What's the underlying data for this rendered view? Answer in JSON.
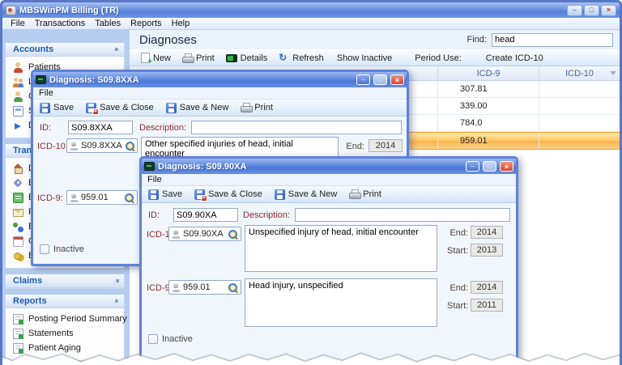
{
  "window": {
    "title": "MBSWinPM Billing (TR)",
    "app_icon": "app-icon"
  },
  "controls": {
    "minimize": "–",
    "maximize": "□",
    "close": "×"
  },
  "menubar": {
    "items": [
      "File",
      "Transactions",
      "Tables",
      "Reports",
      "Help"
    ]
  },
  "sidebar": {
    "sections": [
      {
        "title": "Accounts",
        "collapsed": false,
        "items": [
          {
            "label": "Patients",
            "icon": "person-red-icon"
          },
          {
            "label": "L",
            "icon": "people-pair-icon"
          },
          {
            "label": "C",
            "icon": "person-green-icon"
          },
          {
            "label": "S",
            "icon": "card-icon"
          },
          {
            "label": "D",
            "icon": "arrow-blue-icon"
          }
        ]
      },
      {
        "title": "Transactions",
        "collapsed": false,
        "items": [
          {
            "label": "D",
            "icon": "house-icon"
          },
          {
            "label": "B",
            "icon": "tag-icon"
          },
          {
            "label": "B",
            "icon": "note-icon"
          },
          {
            "label": "P",
            "icon": "envelope-icon"
          },
          {
            "label": "B",
            "icon": "people-sync-icon"
          },
          {
            "label": "C",
            "icon": "calendar-icon"
          },
          {
            "label": "B",
            "icon": "coins-icon"
          }
        ]
      },
      {
        "title": "Claims",
        "collapsed": true,
        "items": []
      },
      {
        "title": "Reports",
        "collapsed": false,
        "items": [
          {
            "label": "Posting Period Summary",
            "icon": "report-icon"
          },
          {
            "label": "Statements",
            "icon": "report-icon"
          },
          {
            "label": "Patient Aging",
            "icon": "report-icon"
          }
        ]
      }
    ]
  },
  "main": {
    "title": "Diagnoses",
    "find": {
      "label": "Find:",
      "value": "head"
    },
    "toolbar": {
      "new": "New",
      "print": "Print",
      "details": "Details",
      "refresh": "Refresh",
      "show_inactive": "Show Inactive",
      "period_use": "Period Use:",
      "create_icd10": "Create ICD-10"
    },
    "table": {
      "columns": {
        "icd9": "ICD-9",
        "icd10": "ICD-10"
      },
      "rows": [
        {
          "icd9": "307.81",
          "icd10": ""
        },
        {
          "icd9": "339.00",
          "icd10": ""
        },
        {
          "icd9": "784.0",
          "icd10": ""
        },
        {
          "icd9": "959.01",
          "icd10": ""
        }
      ],
      "selected_row_icd9": "959.01"
    }
  },
  "dialog1": {
    "title": "Diagnosis: S09.8XXA",
    "menu": {
      "file": "File"
    },
    "toolbar": {
      "save": "Save",
      "save_close": "Save & Close",
      "save_new": "Save & New",
      "print": "Print"
    },
    "id": {
      "label": "ID:",
      "value": "S09.8XXA"
    },
    "description": {
      "label": "Description:",
      "value": ""
    },
    "icd10": {
      "label": "ICD-10:",
      "code": "S09.8XXA",
      "description": "Other specified injuries of head, initial encounter",
      "end_label": "End:",
      "end": "2014"
    },
    "icd9": {
      "label": "ICD-9:",
      "code": "959.01"
    },
    "inactive_label": "Inactive"
  },
  "dialog2": {
    "title": "Diagnosis: S09.90XA",
    "menu": {
      "file": "File"
    },
    "toolbar": {
      "save": "Save",
      "save_close": "Save & Close",
      "save_new": "Save & New",
      "print": "Print"
    },
    "id": {
      "label": "ID:",
      "value": "S09.90XA"
    },
    "description": {
      "label": "Description:",
      "value": ""
    },
    "icd10": {
      "label": "ICD-10:",
      "code": "S09.90XA",
      "description": "Unspecified injury of head, initial encounter",
      "end_label": "End:",
      "end": "2014",
      "start_label": "Start:",
      "start": "2013"
    },
    "icd9": {
      "label": "ICD-9:",
      "code": "959.01",
      "description": "Head injury, unspecified",
      "end_label": "End:",
      "end": "2014",
      "start_label": "Start:",
      "start": "2011"
    },
    "inactive_label": "Inactive"
  },
  "colors": {
    "titlebar_blue": "#5580d8",
    "dialog_border_blue": "#5f82d8",
    "selection_orange": "#fcb64f",
    "field_label_maroon": "#8b2e2e",
    "sidebar_header_blue": "#1f5aa8"
  }
}
